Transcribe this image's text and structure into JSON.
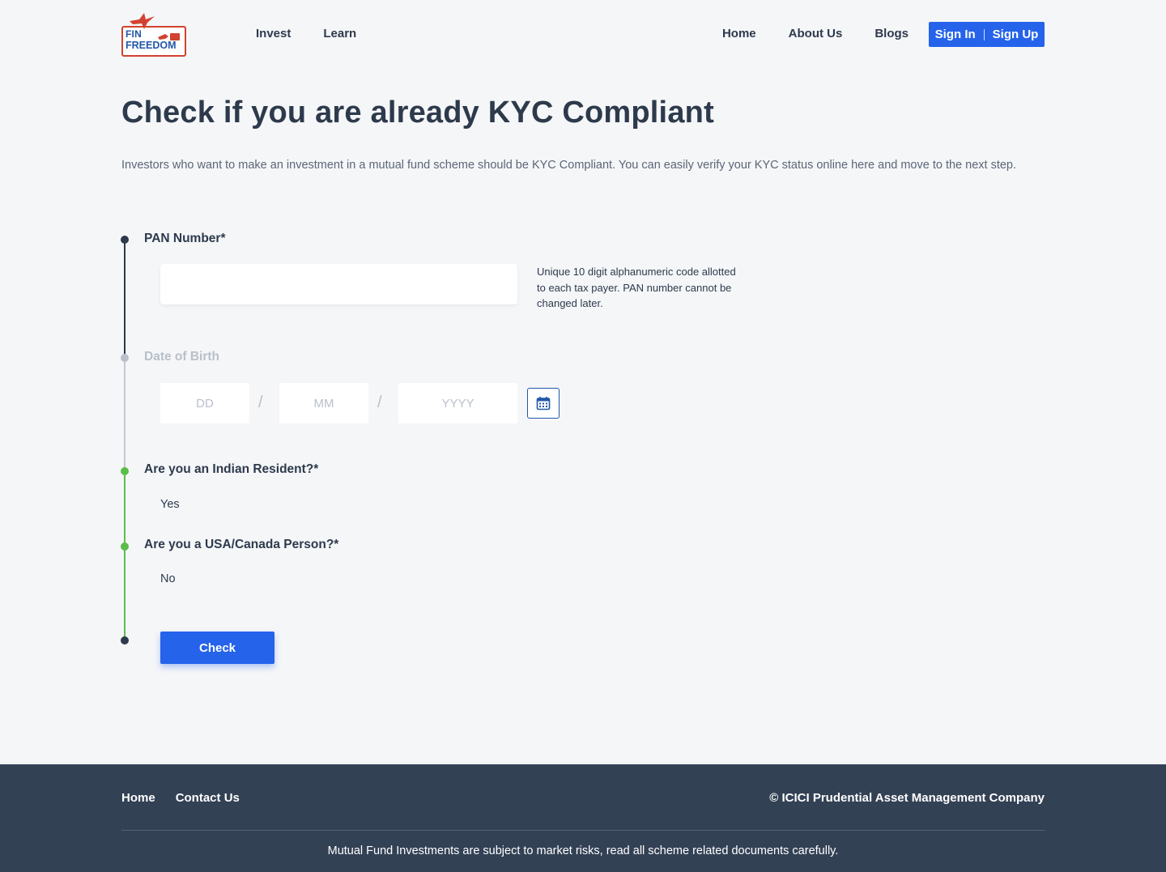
{
  "brand": {
    "logo_line1": "FIN",
    "logo_line2": "FREEDOM"
  },
  "nav": {
    "left": [
      "Invest",
      "Learn"
    ],
    "right": [
      "Home",
      "About Us",
      "Blogs"
    ],
    "sign_in": "Sign In",
    "sign_up": "Sign Up"
  },
  "page": {
    "title": "Check if you are already KYC Compliant",
    "description": "Investors who want to make an investment in a mutual fund scheme should be KYC Compliant. You can easily verify your KYC status online here and move to the next step."
  },
  "form": {
    "pan": {
      "label": "PAN Number*",
      "value": "",
      "help": "Unique 10 digit alphanumeric code allotted to each tax payer. PAN number cannot be changed later."
    },
    "dob": {
      "label": "Date of Birth",
      "dd_placeholder": "DD",
      "mm_placeholder": "MM",
      "yyyy_placeholder": "YYYY",
      "separator": "/"
    },
    "resident": {
      "label": "Are you an Indian Resident?*",
      "value": "Yes"
    },
    "usa_canada": {
      "label": "Are you a USA/Canada Person?*",
      "value": "No"
    },
    "submit_label": "Check"
  },
  "footer": {
    "links": [
      "Home",
      "Contact Us"
    ],
    "copyright": "© ICICI Prudential Asset Management Company",
    "disclaimer": "Mutual Fund Investments are subject to market risks, read all scheme related documents carefully."
  },
  "colors": {
    "accent": "#2563eb",
    "text": "#2d3a4c",
    "step_active": "#2d3a4c",
    "step_done": "#5bbd4a",
    "step_pending": "#b9c0ca",
    "footer_bg": "#334155"
  }
}
